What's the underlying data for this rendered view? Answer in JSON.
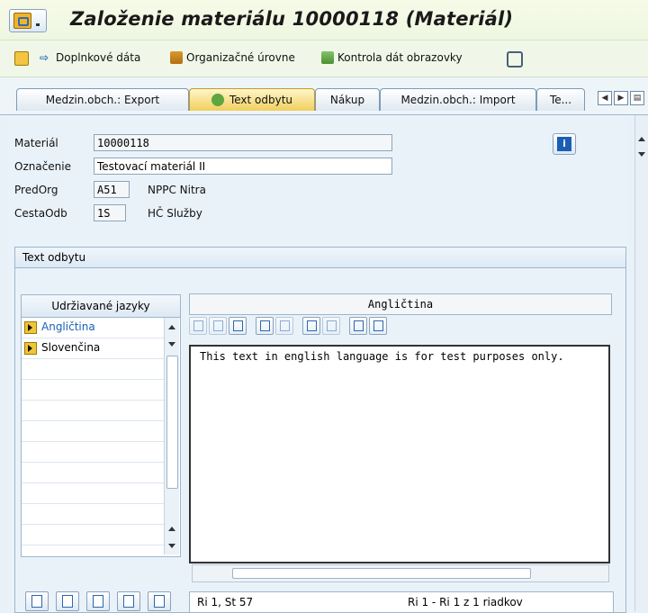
{
  "window": {
    "title": "Založenie materiálu 10000118 (Materiál)"
  },
  "toolbar": {
    "items": [
      {
        "label": "Doplnkové dáta",
        "icon": "arrow-right-icon"
      },
      {
        "label": "Organizačné úrovne",
        "icon": "org-levels-icon"
      },
      {
        "label": "Kontrola dát obrazovky",
        "icon": "check-data-icon"
      }
    ]
  },
  "tabs": [
    {
      "label": "Medzin.obch.: Export",
      "active": false
    },
    {
      "label": "Text odbytu",
      "active": true
    },
    {
      "label": "Nákup",
      "active": false
    },
    {
      "label": "Medzin.obch.: Import",
      "active": false
    },
    {
      "label": "Te...",
      "active": false
    }
  ],
  "header": {
    "material_label": "Materiál",
    "material_value": "10000118",
    "designation_label": "Označenie",
    "designation_value": "Testovací materiál II",
    "sales_org_label": "PredOrg",
    "sales_org_code": "A51",
    "sales_org_name": "NPPC Nitra",
    "distr_channel_label": "CestaOdb",
    "distr_channel_code": "1S",
    "distr_channel_name": "HČ Služby"
  },
  "group": {
    "title": "Text odbytu"
  },
  "languages": {
    "header": "Udržiavané jazyky",
    "items": [
      {
        "label": "Angličtina",
        "selected": true
      },
      {
        "label": "Slovenčina",
        "selected": false
      }
    ]
  },
  "editor": {
    "language_title": "Angličtina",
    "content": "This text in english language is for test purposes only."
  },
  "status": {
    "position": "Ri 1, St 57",
    "range": "Ri 1 - Ri 1 z 1 riadkov"
  }
}
